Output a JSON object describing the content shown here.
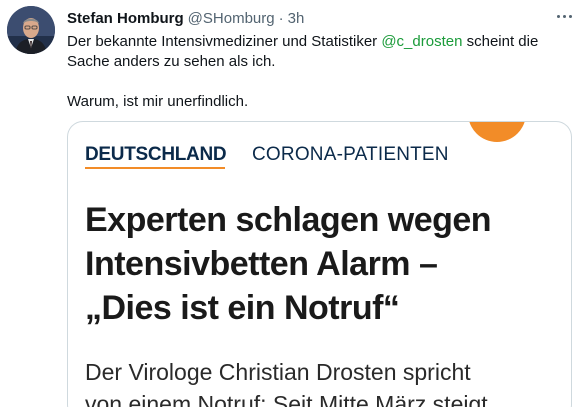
{
  "tweet": {
    "author_name": "Stefan Homburg",
    "handle": "@SHomburg",
    "separator": "·",
    "time": "3h",
    "text_before_mention": "Der bekannte Intensivmediziner und Statistiker ",
    "mention": "@c_drosten",
    "text_after_mention": " scheint die Sache anders zu sehen als ich.",
    "text_second_paragraph": "Warum, ist mir unerfindlich.",
    "more_icon": "more-horizontal-icon"
  },
  "card": {
    "section": "DEUTSCHLAND",
    "category": "CORONA-PATIENTEN",
    "headline_line1": "Experten schlagen wegen",
    "headline_line2": "Intensivbetten Alarm –",
    "headline_line3": "„Dies ist ein Notruf“",
    "lead_line1": "Der Virologe Christian Drosten spricht",
    "lead_line2": "von einem Notruf: Seit Mitte März steigt"
  },
  "colors": {
    "mention": "#1b9b3a",
    "accent_orange": "#f28c28",
    "section_blue": "#0b2a4a",
    "secondary_text": "#536471"
  }
}
